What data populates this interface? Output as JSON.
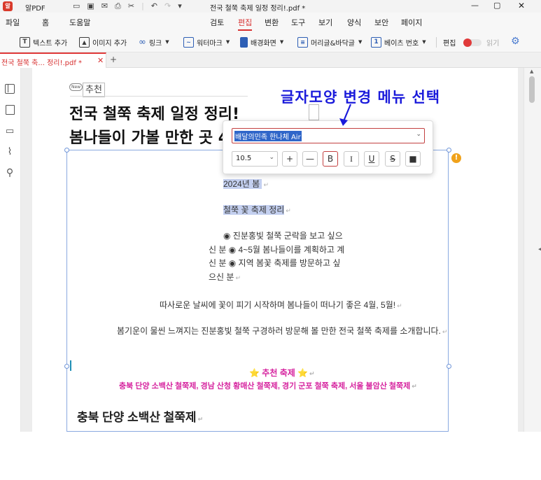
{
  "app": {
    "name": "알PDF",
    "window_title": "전국 철쭉 축제 일정 정리!.pdf *"
  },
  "menu": {
    "left": [
      "파일",
      "홈",
      "도움말"
    ],
    "tabs": [
      "검토",
      "편집",
      "변환",
      "도구",
      "보기",
      "양식",
      "보안",
      "페이지"
    ],
    "active_tab": "편집"
  },
  "toolbar": {
    "add_text": "텍스트 추가",
    "add_image": "이미지 추가",
    "link": "링크",
    "watermark": "워터마크",
    "background": "배경화면",
    "header_footer": "머리글&바닥글",
    "bates": "베이츠 번호",
    "edit": "편집",
    "read": "읽기"
  },
  "doc_tab": {
    "label": "전국 철쭉 축... 정리!.pdf *",
    "add": "+"
  },
  "annotation": {
    "text": "글자모양 변경 메뉴 선택",
    "color": "#1a1adb"
  },
  "font_popup": {
    "font_name": "배달의민족 한나체 Air",
    "font_size": "10.5",
    "plus": "+",
    "minus": "—",
    "bold": "B",
    "italic": "I",
    "underline": "U",
    "strike": "S",
    "color_box": "■"
  },
  "page": {
    "badge_new": "New",
    "recommend": "추천",
    "title_line1": "전국 철쭉 축제 일정 정리!",
    "title_line2": "봄나들이 가볼 만한 곳 4",
    "lines": {
      "spring": "2024년  봄 ",
      "festival_list": "철쭉 꽃 축제 정리",
      "b1": "◉ 진분홍빛 철쭉 군락을 보고 싶으",
      "b1b": "신 분 ◉ 4~5월 봄나들이를 계획하고 계",
      "b2": "신 분 ◉ 지역 봄꽃 축제를 방문하고 싶",
      "b3": "으신 분",
      "intro1": "따사로운 날씨에 꽃이 피기 시작하며 봄나들이 떠나기 좋은 4월, 5월!",
      "intro2": "봄기운이 물씬 느껴지는 진분홍빛 철쭉 구경하러 방문해 볼 만한 전국 철쭉 축제를 소개합니다.",
      "rec_head": "⭐ 추천 축제 ⭐",
      "rec_list": "충북 단양 소백산 철쭉제, 경남 산청 황매산 철쭉제, 경기 군포 철쭉 축제, 서울 불암산 철쭉제",
      "section": "충북 단양 소백산 철쭉제"
    },
    "para_mark": "↵",
    "warn": "!"
  },
  "colors": {
    "accent": "#e03a3a",
    "pink": "#d6249f",
    "highlight": "#c4d0f0"
  },
  "icons": [
    "app-logo-icon",
    "folder-icon",
    "save-icon",
    "mail-icon",
    "print-icon",
    "scissors-icon",
    "undo-icon",
    "redo-icon",
    "quick-menu-icon",
    "minimize-icon",
    "maximize-icon",
    "close-icon"
  ]
}
